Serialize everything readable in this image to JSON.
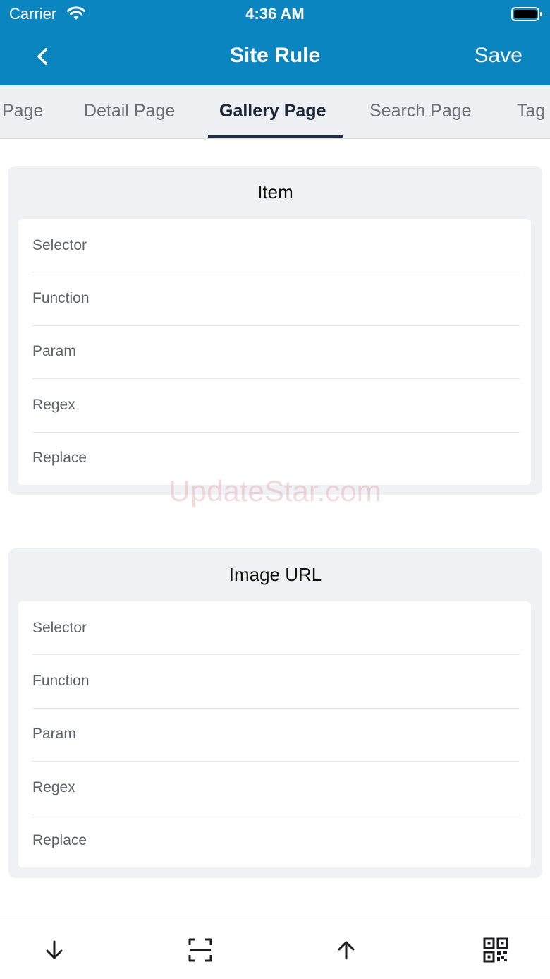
{
  "status_bar": {
    "carrier": "Carrier",
    "time": "4:36 AM"
  },
  "nav": {
    "title": "Site Rule",
    "save_label": "Save",
    "back_icon": "chevron-left-icon"
  },
  "tabs": [
    {
      "label": "Page",
      "active": false
    },
    {
      "label": "Detail Page",
      "active": false
    },
    {
      "label": "Gallery Page",
      "active": true
    },
    {
      "label": "Search Page",
      "active": false
    },
    {
      "label": "Tag",
      "active": false
    }
  ],
  "sections": [
    {
      "title": "Item",
      "fields": [
        {
          "placeholder": "Selector",
          "value": ""
        },
        {
          "placeholder": "Function",
          "value": ""
        },
        {
          "placeholder": "Param",
          "value": ""
        },
        {
          "placeholder": "Regex",
          "value": ""
        },
        {
          "placeholder": "Replace",
          "value": ""
        }
      ]
    },
    {
      "title": "Image URL",
      "fields": [
        {
          "placeholder": "Selector",
          "value": ""
        },
        {
          "placeholder": "Function",
          "value": ""
        },
        {
          "placeholder": "Param",
          "value": ""
        },
        {
          "placeholder": "Regex",
          "value": ""
        },
        {
          "placeholder": "Replace",
          "value": ""
        }
      ]
    }
  ],
  "watermark": "UpdateStar.com",
  "toolbar": {
    "icons": [
      "arrow-down-icon",
      "scan-frame-icon",
      "arrow-up-icon",
      "qr-code-icon"
    ]
  },
  "colors": {
    "header_bg": "#0a85c0",
    "tab_bg": "#eef0f3",
    "active_tab_text": "#1a2638",
    "card_bg": "#f0f1f4"
  }
}
